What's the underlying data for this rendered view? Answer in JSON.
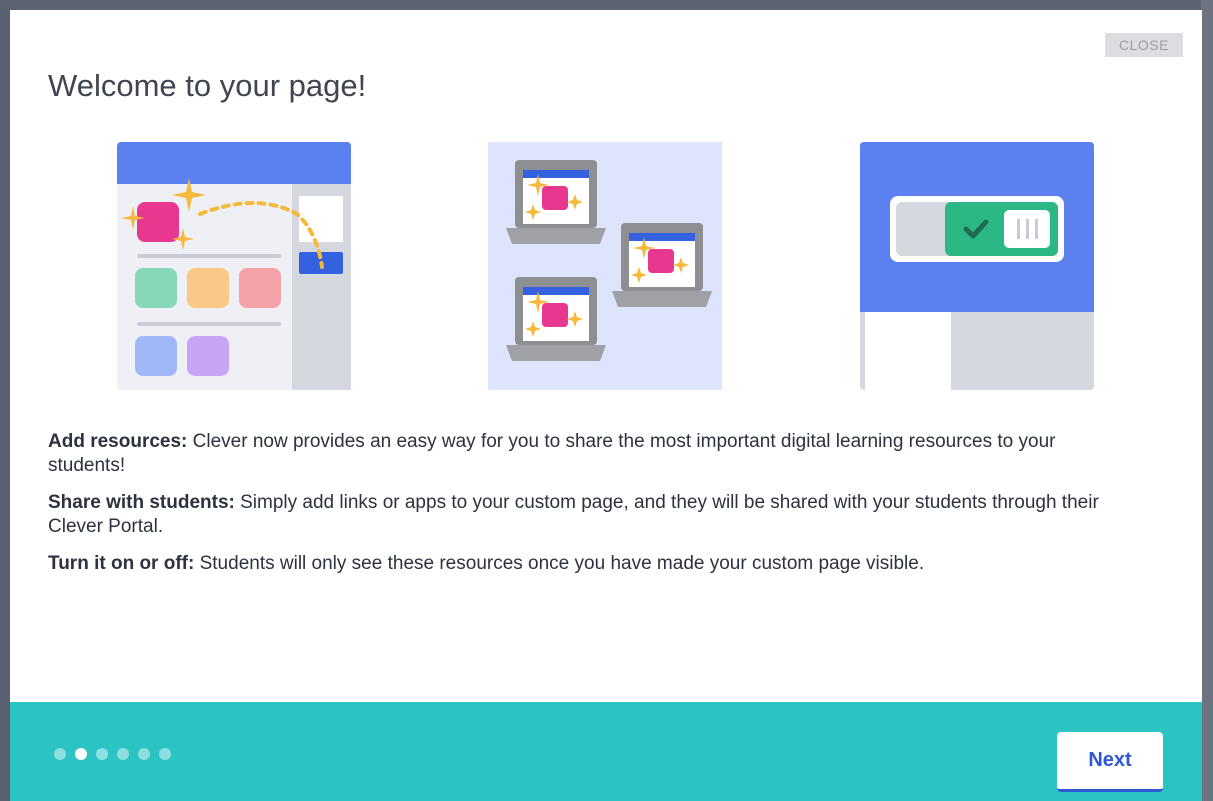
{
  "modal": {
    "close_label": "CLOSE",
    "title": "Welcome to your page!"
  },
  "illustrations": [
    {
      "icon": "resources-illustration"
    },
    {
      "icon": "laptops-illustration"
    },
    {
      "icon": "toggle-illustration"
    }
  ],
  "sections": [
    {
      "heading": "Add resources:",
      "text": " Clever now provides an easy way for you to share the most important digital learning resources to your students!"
    },
    {
      "heading": "Share with students:",
      "text": " Simply add links or apps to your custom page, and they will be shared with your students through their Clever Portal."
    },
    {
      "heading": "Turn it on or off:",
      "text": " Students will only see these resources once you have made your custom page visible."
    }
  ],
  "footer": {
    "step_count": 6,
    "active_step": 2,
    "next_label": "Next"
  },
  "colors": {
    "accent": "#2bc4c2",
    "brand_blue": "#2f58d6",
    "pink": "#e8378f",
    "sparkle": "#f6b93b",
    "toggle_green": "#2bb885"
  }
}
